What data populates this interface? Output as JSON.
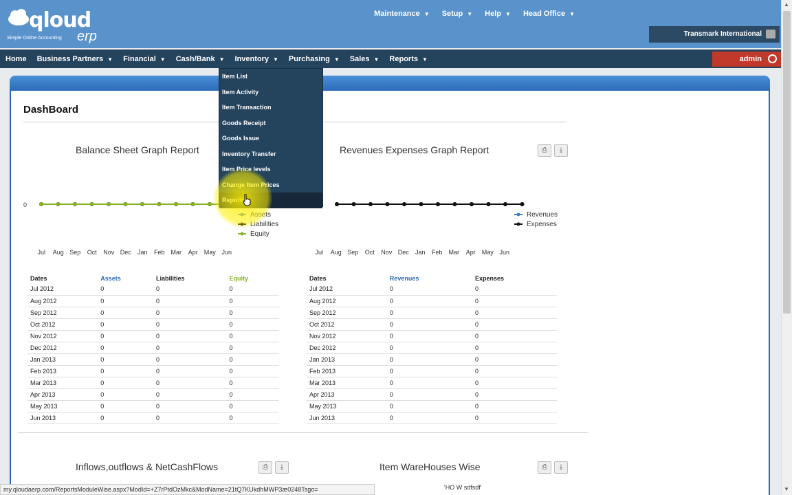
{
  "logo": {
    "brand": "qloud",
    "brand2": "erp",
    "tagline": "Simple Online Accounting"
  },
  "top_menu": [
    "Maintenance",
    "Setup",
    "Help",
    "Head Office"
  ],
  "company": "Transmark International",
  "nav": [
    "Home",
    "Business Partners",
    "Financial",
    "Cash/Bank",
    "Inventory",
    "Purchasing",
    "Sales",
    "Reports"
  ],
  "admin": "admin",
  "dropdown": [
    "Item List",
    "Item Activity",
    "Item Transaction",
    "Goods Receipt",
    "Goods Issue",
    "Inventory Transfer",
    "Item Price levels",
    "Change Item Prices",
    "Reports"
  ],
  "dashboard_title": "DashBoard",
  "sections": {
    "balance": "Balance Sheet Graph Report",
    "revexp": "Revenues Expenses Graph Report",
    "inflows": "Inflows,outflows & NetCashFlows",
    "warehouse": "Item WareHouses Wise"
  },
  "months": [
    "Jul",
    "Aug",
    "Sep",
    "Oct",
    "Nov",
    "Dec",
    "Jan",
    "Feb",
    "Mar",
    "Apr",
    "May",
    "Jun"
  ],
  "chart_data": [
    {
      "type": "line",
      "categories": [
        "Jul",
        "Aug",
        "Sep",
        "Oct",
        "Nov",
        "Dec",
        "Jan",
        "Feb",
        "Mar",
        "Apr",
        "May",
        "Jun"
      ],
      "series": [
        {
          "name": "Assets",
          "values": [
            0,
            0,
            0,
            0,
            0,
            0,
            0,
            0,
            0,
            0,
            0,
            0
          ],
          "color": "#3a7fc9"
        },
        {
          "name": "Liabilities",
          "values": [
            0,
            0,
            0,
            0,
            0,
            0,
            0,
            0,
            0,
            0,
            0,
            0
          ],
          "color": "#111111"
        },
        {
          "name": "Equity",
          "values": [
            0,
            0,
            0,
            0,
            0,
            0,
            0,
            0,
            0,
            0,
            0,
            0
          ],
          "color": "#8ab026"
        }
      ],
      "ytick": "0",
      "legend": "bottom-right"
    },
    {
      "type": "line",
      "categories": [
        "Jul",
        "Aug",
        "Sep",
        "Oct",
        "Nov",
        "Dec",
        "Jan",
        "Feb",
        "Mar",
        "Apr",
        "May",
        "Jun"
      ],
      "series": [
        {
          "name": "Revenues",
          "values": [
            0,
            0,
            0,
            0,
            0,
            0,
            0,
            0,
            0,
            0,
            0,
            0
          ],
          "color": "#3a7fc9"
        },
        {
          "name": "Expenses",
          "values": [
            0,
            0,
            0,
            0,
            0,
            0,
            0,
            0,
            0,
            0,
            0,
            0
          ],
          "color": "#111111"
        }
      ],
      "legend": "right"
    }
  ],
  "balance_table": {
    "headers": [
      "Dates",
      "Assets",
      "Liabilities",
      "Equity"
    ],
    "rows": [
      [
        "Jul 2012",
        "0",
        "0",
        "0"
      ],
      [
        "Aug 2012",
        "0",
        "0",
        "0"
      ],
      [
        "Sep 2012",
        "0",
        "0",
        "0"
      ],
      [
        "Oct 2012",
        "0",
        "0",
        "0"
      ],
      [
        "Nov 2012",
        "0",
        "0",
        "0"
      ],
      [
        "Dec 2012",
        "0",
        "0",
        "0"
      ],
      [
        "Jan 2013",
        "0",
        "0",
        "0"
      ],
      [
        "Feb 2013",
        "0",
        "0",
        "0"
      ],
      [
        "Mar 2013",
        "0",
        "0",
        "0"
      ],
      [
        "Apr 2013",
        "0",
        "0",
        "0"
      ],
      [
        "May 2013",
        "0",
        "0",
        "0"
      ],
      [
        "Jun 2013",
        "0",
        "0",
        "0"
      ]
    ]
  },
  "revexp_table": {
    "headers": [
      "Dates",
      "Revenues",
      "Expenses"
    ],
    "rows": [
      [
        "Jul 2012",
        "0",
        "0"
      ],
      [
        "Aug 2012",
        "0",
        "0"
      ],
      [
        "Sep 2012",
        "0",
        "0"
      ],
      [
        "Oct 2012",
        "0",
        "0"
      ],
      [
        "Nov 2012",
        "0",
        "0"
      ],
      [
        "Dec 2012",
        "0",
        "0"
      ],
      [
        "Jan 2013",
        "0",
        "0"
      ],
      [
        "Feb 2013",
        "0",
        "0"
      ],
      [
        "Mar 2013",
        "0",
        "0"
      ],
      [
        "Apr 2013",
        "0",
        "0"
      ],
      [
        "May 2013",
        "0",
        "0"
      ],
      [
        "Jun 2013",
        "0",
        "0"
      ]
    ]
  },
  "pie_label": "'HO W sdfsdf'",
  "status_url": "my.qloudaerp.com/ReportsModuleWise.aspx?ModId=+Z7rPtdOzMkc&ModName=21tQ7KUkdhMWP3æ0248Tsgo="
}
